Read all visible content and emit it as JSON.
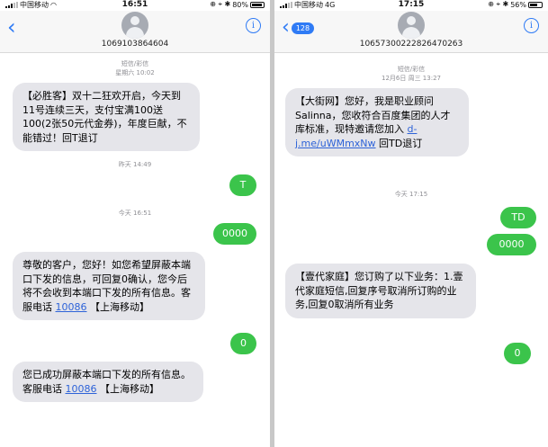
{
  "left": {
    "status": {
      "carrier": "中国移动",
      "time": "16:51",
      "icons": "⊕ ⌖ ✱",
      "battery": "80%",
      "battery_level": 0.8
    },
    "contact_number": "1069103864604",
    "messages": {
      "meta1_line1": "短信/彩信",
      "meta1_line2": "星期六 10:02",
      "m1": "【必胜客】双十二狂欢开启，今天到11号连续三天，支付宝满100送100(2张50元代金券)，年度巨献，不能错过！回T退订",
      "meta2": "昨天 14:49",
      "s1": "T",
      "meta3": "今天 16:51",
      "s2": "0000",
      "m2_text": "尊敬的客户，您好！如您希望屏蔽本端口下发的信息，可回复0确认，您今后将不会收到本端口下发的所有信息。客服电话 ",
      "m2_link": "10086",
      "m2_tail": " 【上海移动】",
      "s3": "0",
      "m3_text": "您已成功屏蔽本端口下发的所有信息。客服电话 ",
      "m3_link": "10086",
      "m3_tail": " 【上海移动】"
    }
  },
  "right": {
    "status": {
      "carrier": "中国移动",
      "network": "4G",
      "time": "17:15",
      "icons": "⊕ ⌖ ✱",
      "battery": "56%",
      "battery_level": 0.56
    },
    "back_badge": "128",
    "contact_number": "10657300222826470263",
    "messages": {
      "meta1_line1": "短信/彩信",
      "meta1_line2": "12月6日 周三 13:27",
      "m1_text": "【大街网】您好，我是职业顾问Salinna，您收符合百度集团的人才库标准，现特邀请您加入 ",
      "m1_link": "d-j.me/uWMmxNw",
      "m1_tail": " 回TD退订",
      "meta2": "今天 17:15",
      "s1": "TD",
      "s2": "0000",
      "m2": "【壹代家庭】您订购了以下业务：1.壹代家庭短信,回复序号取消所订购的业务,回复0取消所有业务",
      "s3": "0"
    }
  },
  "colors": {
    "sent_bubble": "#3bc44b",
    "received_bubble": "#e5e5ea",
    "ios_blue": "#2f7bf5",
    "link": "#2e63d8"
  }
}
